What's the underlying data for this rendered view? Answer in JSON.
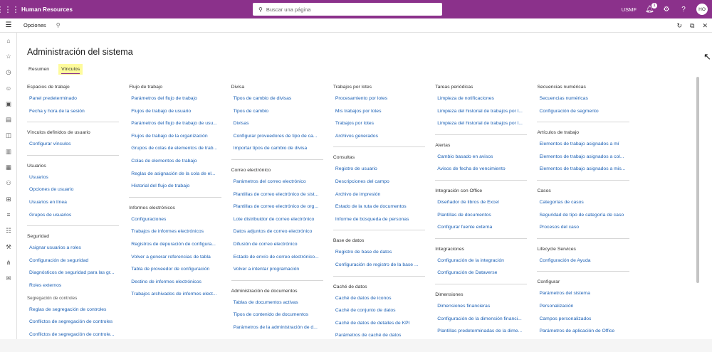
{
  "topbar": {
    "app_title": "Human Resources",
    "search_placeholder": "Buscar una página",
    "company": "USMF",
    "notification_count": "1",
    "avatar_initials": "HO",
    "color": "#8b318b"
  },
  "actionbar": {
    "label": "Opciones"
  },
  "page": {
    "title": "Administración del sistema",
    "tabs": [
      {
        "label": "Resumen",
        "active": false
      },
      {
        "label": "Vínculos",
        "active": true
      }
    ]
  },
  "columns": [
    {
      "groups": [
        {
          "title": "Espacios de trabajo",
          "links": [
            "Panel predeterminado",
            "Fecha y hora de la sesión"
          ]
        },
        {
          "title": "Vínculos definidos de usuario",
          "links": [
            "Configurar vínculos"
          ]
        },
        {
          "title": "Usuarios",
          "links": [
            "Usuarios",
            "Opciones de usuario",
            "Usuarios en línea",
            "Grupos de usuarios"
          ]
        },
        {
          "title": "Seguridad",
          "links": [
            "Asignar usuarios a roles",
            "Configuración de seguridad",
            "Diagnósticos de seguridad para las gr...",
            "Roles externos"
          ],
          "subtitle": "Segregación de controles",
          "sublinks": [
            "Reglas de segregación de controles",
            "Conflictos de segregación de controles",
            "Conflictos de segregación de controle..."
          ]
        }
      ]
    },
    {
      "groups": [
        {
          "title": "Flujo de trabajo",
          "links": [
            "Parámetros del flujo de trabajo",
            "Flujos de trabajo de usuario",
            "Parámetros del flujo de trabajo de usu...",
            "Flujos de trabajo de la organización",
            "Grupos de colas de elementos de trab...",
            "Colas de elementos de trabajo",
            "Reglas de asignación de la cola de el...",
            "Historial del flujo de trabajo"
          ]
        },
        {
          "title": "Informes electrónicos",
          "links": [
            "Configuraciones",
            "Trabajos de informes electrónicos",
            "Registros de depuración de configura...",
            "Volver a generar referencias de tabla",
            "Tabla de proveedor de configuración",
            "Destino de informes electrónicos",
            "Trabajos archivados de informes elect..."
          ]
        }
      ]
    },
    {
      "groups": [
        {
          "title": "Divisa",
          "links": [
            "Tipos de cambio de divisas",
            "Tipos de cambio",
            "Divisas",
            "Configurar proveedores de tipo de ca...",
            "Importar tipos de cambio de divisa"
          ]
        },
        {
          "title": "Correo electrónico",
          "links": [
            "Parámetros del correo electrónico",
            "Plantillas de correo electrónico de sist...",
            "Plantillas de correo electrónico de org...",
            "Lote distribuidor de correo electrónico",
            "Datos adjuntos de correo electrónico",
            "Difusión de correo electrónico",
            "Estado de envío de correo electrónico...",
            "Volver a intentar programación"
          ]
        },
        {
          "title": "Administración de documentos",
          "links": [
            "Tablas de documentos activas",
            "Tipos de contenido de documentos",
            "Parámetros de la administración de d..."
          ]
        }
      ]
    },
    {
      "groups": [
        {
          "title": "Trabajos por lotes",
          "links": [
            "Procesamiento por lotes",
            "Mis trabajos por lotes",
            "Trabajos por lotes",
            "Archivos generados"
          ]
        },
        {
          "title": "Consultas",
          "links": [
            "Registro de usuario",
            "Descripciones del campo",
            "Archivo de impresión",
            "Estado de la ruta de documentos",
            "Informe de búsqueda de personas"
          ]
        },
        {
          "title": "Base de datos",
          "links": [
            "Registro de base de datos",
            "Configuración de registro de la base ..."
          ]
        },
        {
          "title": "Caché de datos",
          "links": [
            "Caché de datos de iconos",
            "Caché de conjunto de datos",
            "Caché de datos de detalles de KPI",
            "Parámetros de caché de datos"
          ]
        }
      ]
    },
    {
      "groups": [
        {
          "title": "Tareas periódicas",
          "links": [
            "Limpieza de notificaciones",
            "Limpieza del historial de trabajos por l...",
            "Limpieza del historial de trabajos por l..."
          ]
        },
        {
          "title": "Alertas",
          "links": [
            "Cambio basado en avisos",
            "Avisos de fecha de vencimiento"
          ]
        },
        {
          "title": "Integración con Office",
          "links": [
            "Diseñador de libros de Excel",
            "Plantillas de documentos",
            "Configurar fuente externa"
          ]
        },
        {
          "title": "Integraciones",
          "links": [
            "Configuración de la integración",
            "Configuración de Dataverse"
          ]
        },
        {
          "title": "Dimensiones",
          "links": [
            "Dimensiones financieras",
            "Configuración de la dimensión financi...",
            "Plantillas predeterminadas de la dime..."
          ]
        }
      ]
    },
    {
      "groups": [
        {
          "title": "Secuencias numéricas",
          "links": [
            "Secuencias numéricas",
            "Configuración de segmento"
          ]
        },
        {
          "title": "Artículos de trabajo",
          "links": [
            "Elementos de trabajo asignados a mí",
            "Elementos de trabajo asignados a col...",
            "Elementos de trabajo asignados a mis..."
          ]
        },
        {
          "title": "Casos",
          "links": [
            "Categorías de casos",
            "Seguridad de tipo de categoría de caso",
            "Procesos del caso"
          ]
        },
        {
          "title": "Lifecycle Services",
          "links": [
            "Configuración de Ayuda"
          ]
        },
        {
          "title": "Configurar",
          "links": [
            "Parámetros del sistema",
            "Personalización",
            "Campos personalizados",
            "Parámetros de aplicación de Office"
          ]
        }
      ]
    }
  ]
}
